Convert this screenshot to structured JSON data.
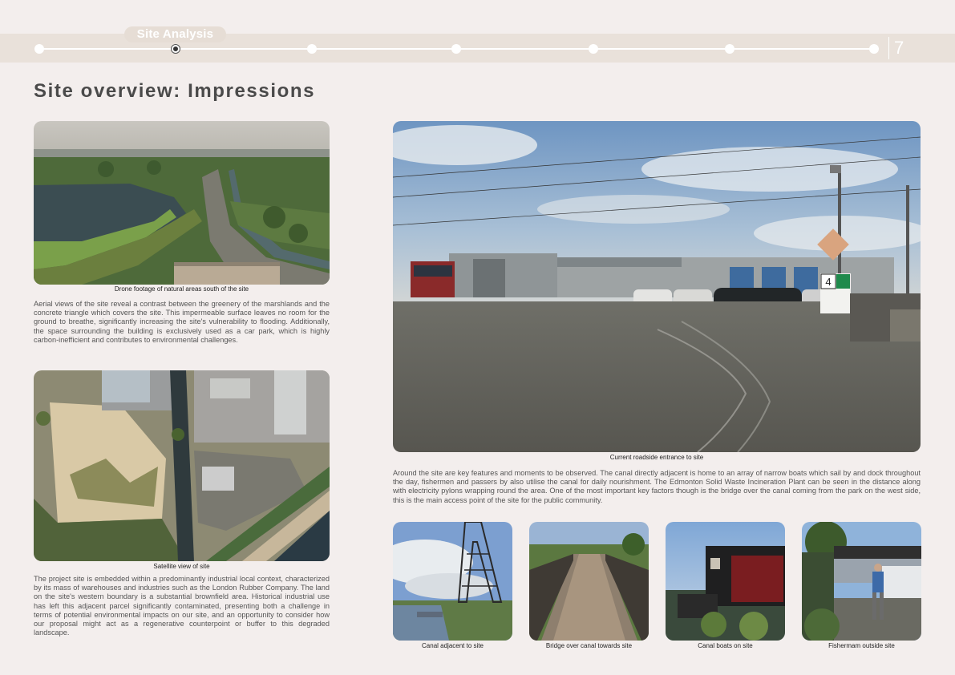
{
  "header": {
    "section_label": "Site Analysis",
    "page_number": "7"
  },
  "title": "Site overview: Impressions",
  "photos": {
    "drone": {
      "caption": "Drone footage of natural areas south of the site"
    },
    "satellite": {
      "caption": "Satellite view of site"
    },
    "entrance": {
      "caption": "Current roadside entrance to site",
      "sign_number": "4"
    },
    "canal": {
      "caption": "Canal adjacent to site"
    },
    "bridge": {
      "caption": "Bridge over canal towards site"
    },
    "boats": {
      "caption": "Canal boats on site"
    },
    "fisherman": {
      "caption": "Fishermam outside site"
    }
  },
  "text": {
    "aerial": "Aerial views of the site reveal a contrast between the greenery of the marshlands and the concrete triangle which covers the site. This impermeable surface leaves no room for the ground to breathe, significantly increasing the site's vulnerability to flooding. Additionally, the space surrounding the building is exclusively used as a car park, which is highly carbon-inefficient and contributes to environmental challenges.",
    "context": "The project site is embedded within a predominantly industrial local context, characterized by its mass of warehouses and industries such as the London Rubber Company. The land on the site's western boundary is a substantial brownfield area. Historical industrial use has left this adjacent parcel significantly contaminated, presenting both a challenge in terms of potential environmental impacts on our site, and an opportunity to consider how our proposal might act as a regenerative counterpoint or buffer to this degraded landscape.",
    "features": "Around the site are key features and moments to be observed. The canal directly adjacent is home to an array of narrow boats which sail by and dock throughout the day, fishermen and passers by also utilise the canal for daily nourishment. The Edmonton Solid Waste Incineration Plant can be seen in the distance along with electricity pylons wrapping round the area. One of the most important key factors though is the bridge over the canal coming from the park on the west side, this is the main access point of the site for the public community."
  }
}
